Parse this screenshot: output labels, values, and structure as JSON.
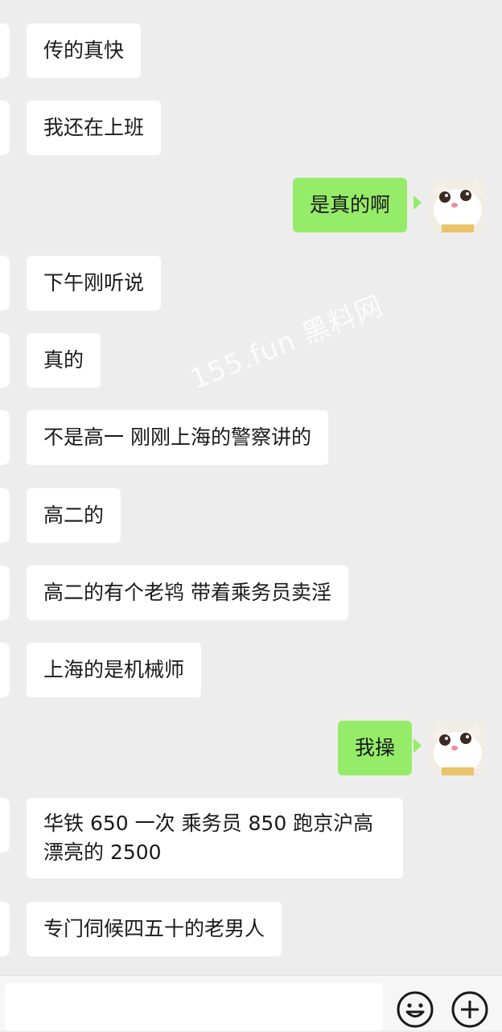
{
  "messages": [
    {
      "side": "left",
      "text": "传的真快"
    },
    {
      "side": "left",
      "text": "我还在上班"
    },
    {
      "side": "right",
      "text": "是真的啊"
    },
    {
      "side": "left",
      "text": "下午刚听说"
    },
    {
      "side": "left",
      "text": "真的"
    },
    {
      "side": "left",
      "text": "不是高一 刚刚上海的警察讲的"
    },
    {
      "side": "left",
      "text": "高二的"
    },
    {
      "side": "left",
      "text": "高二的有个老鸨 带着乘务员卖淫"
    },
    {
      "side": "left",
      "text": "上海的是机械师"
    },
    {
      "side": "right",
      "text": "我操"
    },
    {
      "side": "left",
      "text": "华铁 650 一次 乘务员 850 跑京沪高漂亮的 2500"
    },
    {
      "side": "left",
      "text": "专门伺候四五十的老男人"
    }
  ],
  "watermark": "155.fun 黑料网",
  "input": {
    "value": "",
    "emoji_icon": "smiley-face-icon",
    "more_icon": "plus-circle-icon"
  },
  "colors": {
    "background": "#ededed",
    "incoming_bubble": "#ffffff",
    "outgoing_bubble": "#95ec69"
  }
}
